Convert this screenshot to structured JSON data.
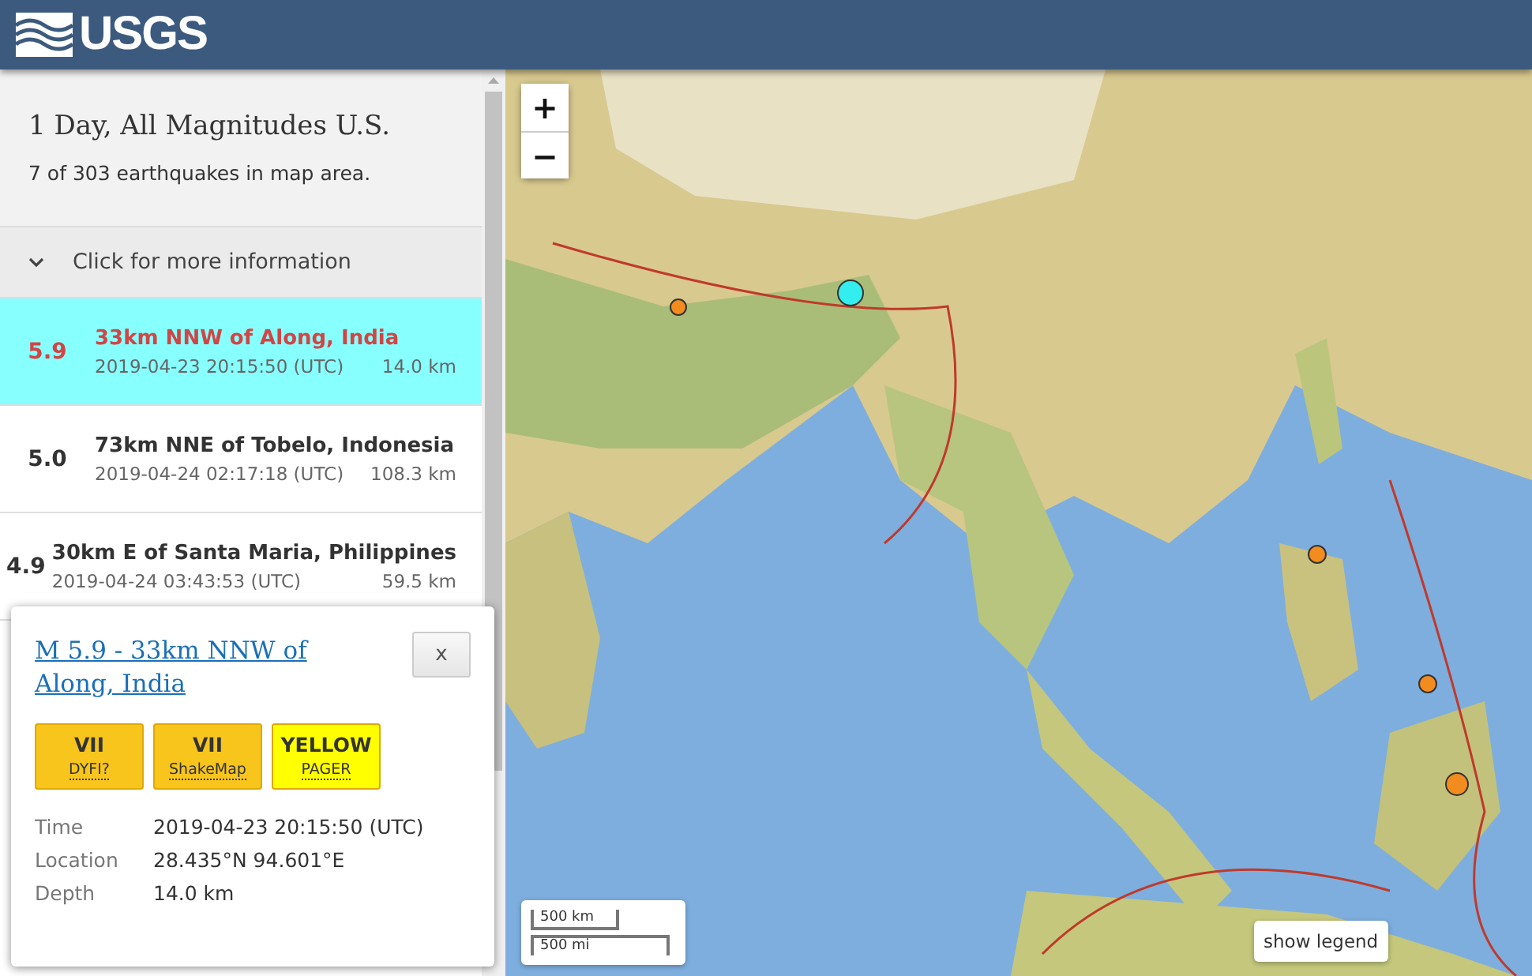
{
  "header": {
    "logo_text": "USGS"
  },
  "summary": {
    "title": "1 Day, All Magnitudes U.S.",
    "count": "7 of 303 earthquakes in map area."
  },
  "more_info": {
    "label": "Click for more information",
    "expanded": false
  },
  "events": [
    {
      "magnitude": "5.9",
      "place": "33km NNW of Along, India",
      "time": "2019-04-23 20:15:50 (UTC)",
      "depth": "14.0 km",
      "selected": true
    },
    {
      "magnitude": "5.0",
      "place": "73km NNE of Tobelo, Indonesia",
      "time": "2019-04-24 02:17:18 (UTC)",
      "depth": "108.3 km",
      "selected": false
    },
    {
      "magnitude": "4.9",
      "place": "30km E of Santa Maria, Philippines",
      "time": "2019-04-24 03:43:53 (UTC)",
      "depth": "59.5 km",
      "selected": false
    }
  ],
  "popup": {
    "title": "M 5.9 - 33km NNW of Along, India",
    "close": "x",
    "badges": [
      {
        "value": "VII",
        "label": "DYFI?",
        "color": "#f8c51c"
      },
      {
        "value": "VII",
        "label": "ShakeMap",
        "color": "#f8c51c"
      },
      {
        "value": "YELLOW",
        "label": "PAGER",
        "color": "#ffff00"
      }
    ],
    "details": [
      {
        "label": "Time",
        "value": "2019-04-23 20:15:50 (UTC)"
      },
      {
        "label": "Location",
        "value": "28.435°N 94.601°E"
      },
      {
        "label": "Depth",
        "value": "14.0 km"
      }
    ]
  },
  "map": {
    "zoom_in": "+",
    "zoom_out": "−",
    "scale": [
      "500 km",
      "500 mi"
    ],
    "legend_button": "show legend",
    "markers": [
      {
        "selected": false
      },
      {
        "selected": true
      },
      {
        "selected": false
      },
      {
        "selected": false
      },
      {
        "selected": false
      }
    ]
  }
}
